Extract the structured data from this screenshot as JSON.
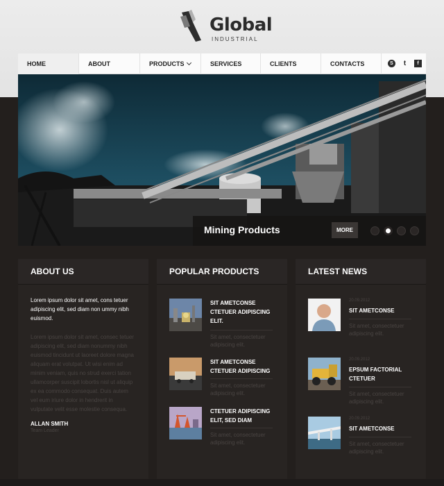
{
  "brand": {
    "title": "Global",
    "subtitle": "INDUSTRIAL"
  },
  "nav": {
    "items": [
      {
        "label": "HOME",
        "active": true
      },
      {
        "label": "ABOUT"
      },
      {
        "label": "PRODUCTS",
        "has_dropdown": true
      },
      {
        "label": "SERVICES"
      },
      {
        "label": "CLIENTS"
      },
      {
        "label": "CONTACTS"
      }
    ],
    "social": [
      {
        "icon": "stumbleupon-icon",
        "glyph": "S"
      },
      {
        "icon": "twitter-icon",
        "glyph": "t"
      },
      {
        "icon": "facebook-icon",
        "glyph": "f"
      }
    ]
  },
  "hero": {
    "title": "Mining Products",
    "more_label": "MORE",
    "slides_total": 4,
    "slide_active": 2
  },
  "about": {
    "heading": "ABOUT US",
    "lead": "Lorem ipsum dolor sit amet, cons tetuer adipiscing elit, sed diam non ummy nibh euismod.",
    "text": "Lorem ipsum dolor sit amet, consec tetuer adipiscing elit, sed diam nonummy nibh euismod tincidunt ut laoreet dolore magna aliquam erat volutpat. Ut wisi enim ad minim veniam, quis no strud exerci tation ullamcorper suscipit lobortis nisl ut aliquip ex ea commodo consequat. Duis autem vel eum iriure dolor in hendrerit in vulputate velit esse molestie consequa.",
    "name": "ALLAN SMITH",
    "role": "Team Leader"
  },
  "products": {
    "heading": "POPULAR PRODUCTS",
    "items": [
      {
        "title": "SIT AMETCONSE CTETUER ADIPISCING ELIT.",
        "text": "Sit amet, consectetuer adipiscing elit."
      },
      {
        "title": "SIT AMETCONSE CTETUER ADIPISCING",
        "text": "Sit amet, consectetuer adipiscing elit."
      },
      {
        "title": "CTETUER ADIPISCING ELIT, SED DIAM",
        "text": "Sit amet, consectetuer adipiscing elit."
      }
    ]
  },
  "news": {
    "heading": "LATEST NEWS",
    "items": [
      {
        "date": "20.09.2012",
        "title": "SIT AMETCONSE",
        "text": "Sit amet, consectetuer adipiscing elit."
      },
      {
        "date": "20.09.2012",
        "title": "EPSUM FACTORIAL CTETUER",
        "text": "Sit amet, consectetuer adipiscing elit."
      },
      {
        "date": "20.09.2012",
        "title": "SIT AMETCONSE",
        "text": "Sit amet, consectetuer adipiscing elit."
      }
    ]
  },
  "colors": {
    "page_bg": "#231f1d",
    "panel_bg": "#282422",
    "header_bg": "#e8e8e8",
    "muted_text": "#4a4543"
  }
}
